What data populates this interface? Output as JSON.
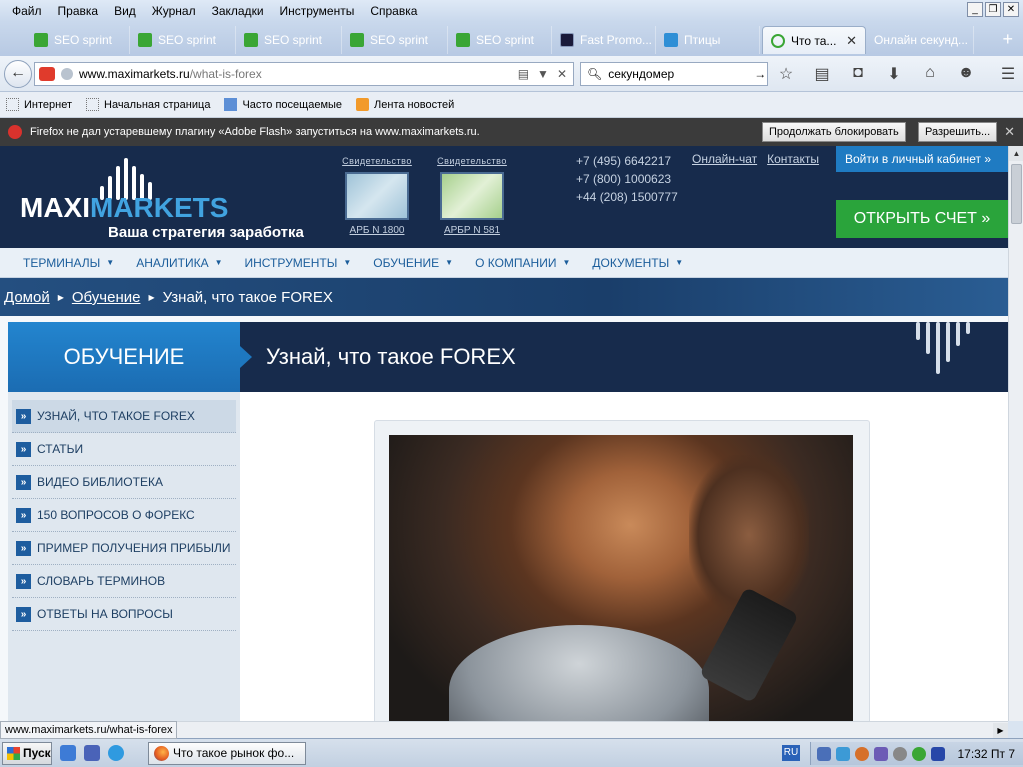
{
  "menubar": {
    "items": [
      "Файл",
      "Правка",
      "Вид",
      "Журнал",
      "Закладки",
      "Инструменты",
      "Справка"
    ]
  },
  "tabs": [
    {
      "label": "SEO sprint",
      "color": "#3aa635"
    },
    {
      "label": "SEO sprint",
      "color": "#3aa635"
    },
    {
      "label": "SEO sprint",
      "color": "#3aa635"
    },
    {
      "label": "SEO sprint",
      "color": "#3aa635"
    },
    {
      "label": "SEO sprint",
      "color": "#3aa635"
    },
    {
      "label": "Fast Promo...",
      "color": "#1a1a3a"
    },
    {
      "label": "Птицы",
      "color": "#2f8fd6"
    },
    {
      "label": "Что та...",
      "color": "#3aa635"
    },
    {
      "label": "Онлайн секунд...",
      "color": ""
    }
  ],
  "navbar": {
    "url_domain": "www.maximarkets.ru",
    "url_path": "/what-is-forex",
    "search_value": "секундомер"
  },
  "bookmarks": [
    "Интернет",
    "Начальная страница",
    "Часто посещаемые",
    "Лента новостей"
  ],
  "notification": {
    "text": "Firefox не дал устаревшему плагину «Adobe Flash» запуститься на www.maximarkets.ru.",
    "continue_label": "Продолжать блокировать",
    "allow_label": "Разрешить..."
  },
  "site": {
    "logo_main": "MAXI",
    "logo_accent": "MARKETS",
    "tagline": "Ваша стратегия заработка",
    "cert1": {
      "title": "Свидетельство",
      "label": "АРБ N 1800"
    },
    "cert2": {
      "title": "Свидетельство",
      "label": "АРБР N 581"
    },
    "phones": [
      "+7 (495) 6642217",
      "+7 (800) 1000623",
      "+44 (208) 1500777"
    ],
    "online_chat": "Онлайн-чат",
    "contacts": "Контакты",
    "cabinet": "Войти в личный кабинет",
    "open_account": "ОТКРЫТЬ СЧЕТ",
    "nav": [
      "ТЕРМИНАЛЫ",
      "АНАЛИТИКА",
      "ИНСТРУМЕНТЫ",
      "ОБУЧЕНИЕ",
      "О КОМПАНИИ",
      "ДОКУМЕНТЫ"
    ],
    "breadcrumb": {
      "home": "Домой",
      "section": "Обучение",
      "current": "Узнай, что такое FOREX"
    },
    "section_title": "ОБУЧЕНИЕ",
    "page_title": "Узнай, что такое FOREX",
    "sidebar": [
      "УЗНАЙ, ЧТО ТАКОЕ FOREX",
      "СТАТЬИ",
      "ВИДЕО БИБЛИОТЕКА",
      "150 ВОПРОСОВ О ФОРЕКС",
      "ПРИМЕР ПОЛУЧЕНИЯ ПРИБЫЛИ",
      "СЛОВАРЬ ТЕРМИНОВ",
      "ОТВЕТЫ НА ВОПРОСЫ"
    ]
  },
  "status_url": "www.maximarkets.ru/what-is-forex",
  "taskbar": {
    "start": "Пуск",
    "window_title": "Что такое рынок фо...",
    "lang": "RU",
    "clock": "17:32 Пт 7"
  },
  "colors": {
    "site_dark": "#172b4c",
    "site_blue": "#1f7bc2",
    "site_green": "#2aa43b"
  }
}
